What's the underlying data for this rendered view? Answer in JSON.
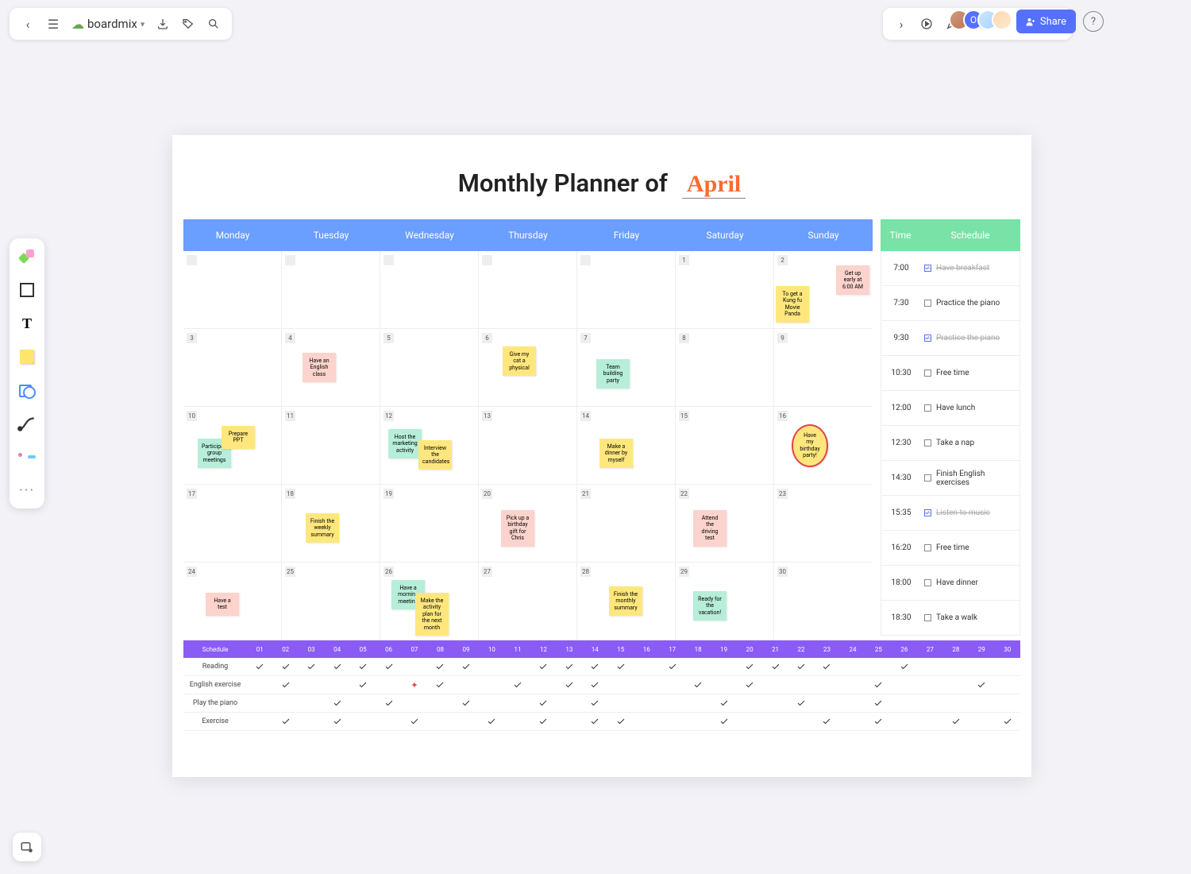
{
  "header": {
    "appname": "boardmix",
    "share": "Share",
    "avatar_initial": "O"
  },
  "canvas": {
    "title": "Monthly Planner of",
    "month": "April",
    "days": [
      "Monday",
      "Tuesday",
      "Wednesday",
      "Thursday",
      "Friday",
      "Saturday",
      "Sunday"
    ],
    "dates_row1": [
      "",
      "",
      "",
      "",
      "",
      "1",
      "2"
    ],
    "dates": [
      "3",
      "4",
      "5",
      "6",
      "7",
      "8",
      "9",
      "10",
      "11",
      "12",
      "13",
      "14",
      "15",
      "16",
      "17",
      "18",
      "19",
      "20",
      "21",
      "22",
      "23",
      "24",
      "25",
      "26",
      "27",
      "28",
      "29",
      "30"
    ],
    "notes": {
      "r1_sun_a": "Get up early at 6:00 AM",
      "r1_sun_b": "To get a Kung fu Movie Panda",
      "r2_tue": "Have an English class",
      "r2_thu": "Give my cat a physical",
      "r2_fri": "Team building party",
      "r3_mon_a": "Participate group meetings",
      "r3_mon_b": "Prepare PPT",
      "r3_wed_a": "Host the marketing activity",
      "r3_wed_b": "Interview the candidates",
      "r3_fri": "Make a dinner by myself",
      "r3_sun": "Have my birthday party!",
      "r4_tue": "Finish the weekly summary",
      "r4_thu": "Pick up a birthday gift for Chris",
      "r4_sat": "Attend the driving test",
      "r5_mon": "Have a test",
      "r5_wed_a": "Have a morning meeting",
      "r5_wed_b": "Make the activity plan for the next month",
      "r5_fri": "Finish the monthly summary",
      "r5_sat": "Ready for the vacation!"
    },
    "sched_head": {
      "time": "Time",
      "schedule": "Schedule"
    },
    "schedule": [
      {
        "t": "7:00",
        "txt": "Have breakfast",
        "done": true
      },
      {
        "t": "7:30",
        "txt": "Practice the piano",
        "done": false
      },
      {
        "t": "9:30",
        "txt": "Practice the piano",
        "done": true
      },
      {
        "t": "10:30",
        "txt": "Free time",
        "done": false
      },
      {
        "t": "12:00",
        "txt": "Have lunch",
        "done": false
      },
      {
        "t": "12:30",
        "txt": "Take a nap",
        "done": false
      },
      {
        "t": "14:30",
        "txt": "Finish English exercises",
        "done": false
      },
      {
        "t": "15:35",
        "txt": "Listen to music",
        "done": true
      },
      {
        "t": "16:20",
        "txt": "Free time",
        "done": false
      },
      {
        "t": "18:00",
        "txt": "Have dinner",
        "done": false
      },
      {
        "t": "18:30",
        "txt": "Take a walk",
        "done": false
      }
    ],
    "tracker_head": "Schedule",
    "tracker_days_prefix": "0",
    "tracker_rows": [
      {
        "label": "Reading",
        "ticks": [
          1,
          1,
          1,
          1,
          1,
          1,
          0,
          1,
          1,
          0,
          0,
          1,
          1,
          1,
          1,
          0,
          1,
          0,
          0,
          1,
          1,
          1,
          1,
          0,
          0,
          1,
          0,
          0,
          0,
          0
        ]
      },
      {
        "label": "English exercise",
        "ticks": [
          0,
          1,
          0,
          0,
          1,
          0,
          2,
          1,
          0,
          0,
          1,
          0,
          1,
          1,
          0,
          0,
          0,
          1,
          0,
          1,
          0,
          0,
          0,
          0,
          1,
          0,
          0,
          0,
          1,
          0
        ]
      },
      {
        "label": "Play the piano",
        "ticks": [
          0,
          0,
          0,
          1,
          0,
          1,
          0,
          0,
          1,
          0,
          0,
          1,
          0,
          1,
          0,
          0,
          0,
          0,
          1,
          0,
          0,
          1,
          0,
          0,
          1,
          0,
          0,
          0,
          0,
          0
        ]
      },
      {
        "label": "Exercise",
        "ticks": [
          0,
          1,
          0,
          1,
          0,
          0,
          1,
          0,
          0,
          1,
          0,
          1,
          0,
          1,
          1,
          0,
          0,
          0,
          1,
          0,
          0,
          0,
          1,
          0,
          1,
          0,
          0,
          1,
          0,
          1
        ]
      }
    ]
  }
}
